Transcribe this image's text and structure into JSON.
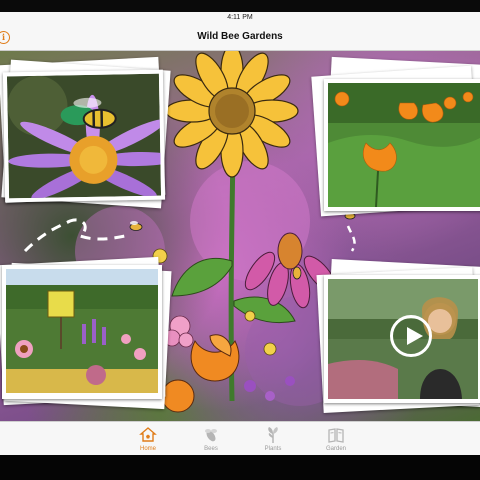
{
  "status_bar": {
    "time": "4:11 PM"
  },
  "nav": {
    "title": "Wild Bee Gardens",
    "info_icon": "info-icon"
  },
  "tabs": [
    {
      "label": "Home",
      "icon": "home-icon",
      "active": true
    },
    {
      "label": "Bees",
      "icon": "bee-icon",
      "active": false
    },
    {
      "label": "Plants",
      "icon": "plant-icon",
      "active": false
    },
    {
      "label": "Garden",
      "icon": "book-icon",
      "active": false
    }
  ],
  "tiles": [
    {
      "name": "bee-on-flower-photo"
    },
    {
      "name": "poppies-photo"
    },
    {
      "name": "garden-sign-photo"
    },
    {
      "name": "video-presenter"
    }
  ],
  "colors": {
    "accent": "#e07d1a",
    "inactive": "#9a9a9a",
    "bar_bg": "#f7f7f7"
  }
}
